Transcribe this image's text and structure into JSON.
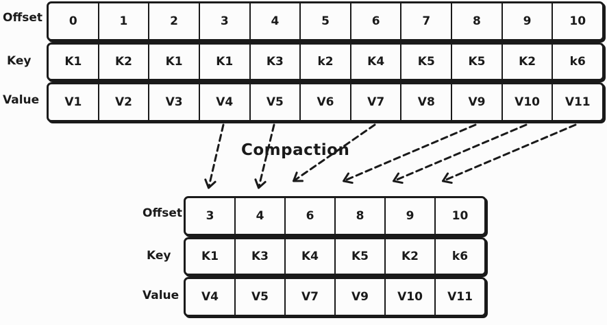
{
  "top_table": {
    "labels": {
      "offset": "Offset",
      "key": "Key",
      "value": "Value"
    },
    "offsets": [
      "0",
      "1",
      "2",
      "3",
      "4",
      "5",
      "6",
      "7",
      "8",
      "9",
      "10"
    ],
    "keys": [
      "K1",
      "K2",
      "K1",
      "K1",
      "K3",
      "k2",
      "K4",
      "K5",
      "K5",
      "K2",
      "k6"
    ],
    "values": [
      "V1",
      "V2",
      "V3",
      "V4",
      "V5",
      "V6",
      "V7",
      "V8",
      "V9",
      "V10",
      "V11"
    ]
  },
  "caption": "Compaction",
  "bottom_table": {
    "labels": {
      "offset": "Offset",
      "key": "Key",
      "value": "Value"
    },
    "offsets": [
      "3",
      "4",
      "6",
      "8",
      "9",
      "10"
    ],
    "keys": [
      "K1",
      "K3",
      "K4",
      "K5",
      "K2",
      "k6"
    ],
    "values": [
      "V4",
      "V5",
      "V7",
      "V9",
      "V10",
      "V11"
    ]
  },
  "arrows": [
    {
      "from_offset": "3",
      "to_offset": "3"
    },
    {
      "from_offset": "4",
      "to_offset": "4"
    },
    {
      "from_offset": "6",
      "to_offset": "6"
    },
    {
      "from_offset": "8",
      "to_offset": "8"
    },
    {
      "from_offset": "9",
      "to_offset": "9"
    },
    {
      "from_offset": "10",
      "to_offset": "10"
    }
  ],
  "colors": {
    "ink": "#1a1a1a",
    "background": "#fcfcfc"
  }
}
